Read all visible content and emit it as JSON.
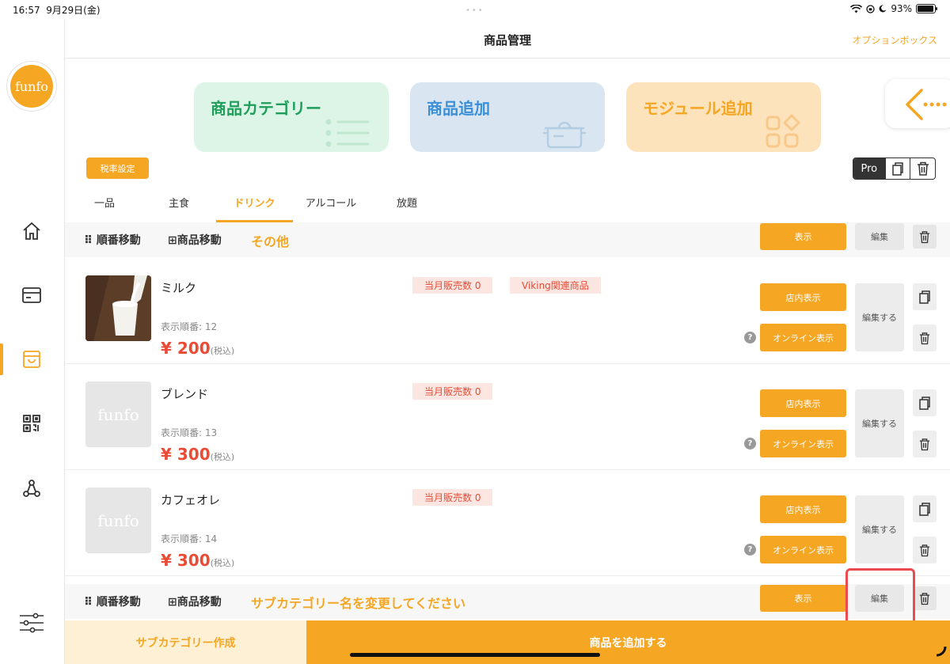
{
  "status": {
    "time": "16:57",
    "date": "9月29日(金)",
    "battery": "93%",
    "battery_level": 0.93
  },
  "sidebar": {
    "logo": "funfo"
  },
  "header": {
    "title": "商品管理",
    "option": "オプションボックス"
  },
  "cards": {
    "category": "商品カテゴリー",
    "add_product": "商品追加",
    "add_module": "モジュール追加"
  },
  "tax_button": "税率設定",
  "pro_label": "Pro",
  "tabs": [
    "一品",
    "主食",
    "ドリンク",
    "アルコール",
    "放題"
  ],
  "active_tab": "ドリンク",
  "subcategory1": {
    "order": "順番移動",
    "move": "商品移動",
    "name": "その他",
    "show": "表示",
    "edit": "編集"
  },
  "subcategory2": {
    "order": "順番移動",
    "move": "商品移動",
    "name": "サブカテゴリー名を変更してください",
    "show": "表示",
    "edit": "編集"
  },
  "products": [
    {
      "name": "ミルク",
      "order_label": "表示順番: 12",
      "price": "¥ 200",
      "tax": "(税込)",
      "sales_badge": "当月販売数 0",
      "viking_badge": "Viking関連商品",
      "store_btn": "店内表示",
      "online_btn": "オンライン表示",
      "edit_btn": "編集する"
    },
    {
      "name": "ブレンド",
      "order_label": "表示順番: 13",
      "price": "¥ 300",
      "tax": "(税込)",
      "sales_badge": "当月販売数 0",
      "placeholder": "funfo",
      "store_btn": "店内表示",
      "online_btn": "オンライン表示",
      "edit_btn": "編集する"
    },
    {
      "name": "カフェオレ",
      "order_label": "表示順番: 14",
      "price": "¥ 300",
      "tax": "(税込)",
      "sales_badge": "当月販売数 0",
      "placeholder": "funfo",
      "store_btn": "店内表示",
      "online_btn": "オンライン表示",
      "edit_btn": "編集する"
    }
  ],
  "footer": {
    "create_sub": "サブカテゴリー作成",
    "add_product": "商品を追加する"
  },
  "colors": {
    "accent": "#f5a623",
    "price": "#e94b35",
    "highlight": "#e94b50"
  }
}
